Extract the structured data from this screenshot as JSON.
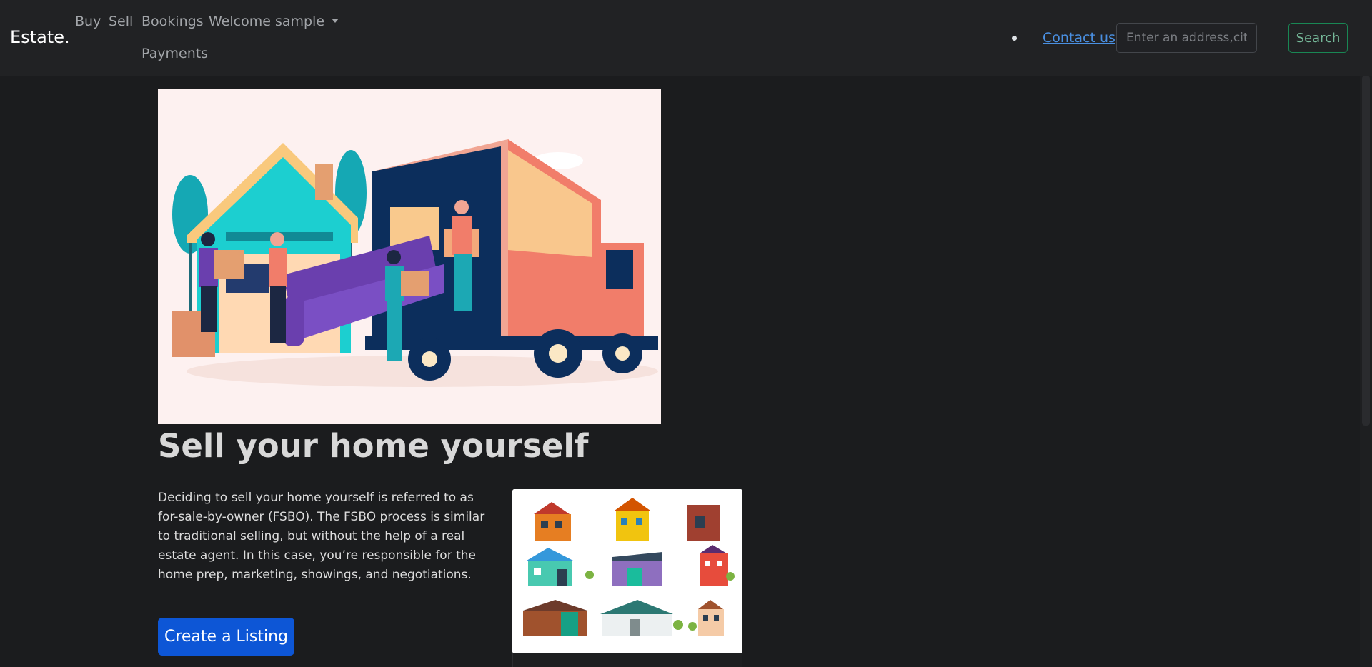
{
  "navbar": {
    "brand": "Estate.",
    "links": [
      "Buy",
      "Sell",
      "Bookings",
      "Payments"
    ],
    "user_menu": "Welcome sample",
    "contact": "Contact us",
    "search": {
      "placeholder": "Enter an address,city,area",
      "button": "Search"
    }
  },
  "main": {
    "title": "Sell your home yourself",
    "description": "Deciding to sell your home yourself is referred to as for-sale-by-owner (FSBO). The FSBO process is similar to traditional selling, but without the help of a real estate agent. In this case, you’re responsible for the home prep, marketing, showings, and negotiations.",
    "cta": "Create a Listing"
  },
  "colors": {
    "accent": "#0d56d6",
    "search_outline": "#198754",
    "link": "#4a90e2",
    "background": "#1b1c1e"
  },
  "icons": [
    "caret-down-icon",
    "bullet-dot-icon"
  ]
}
